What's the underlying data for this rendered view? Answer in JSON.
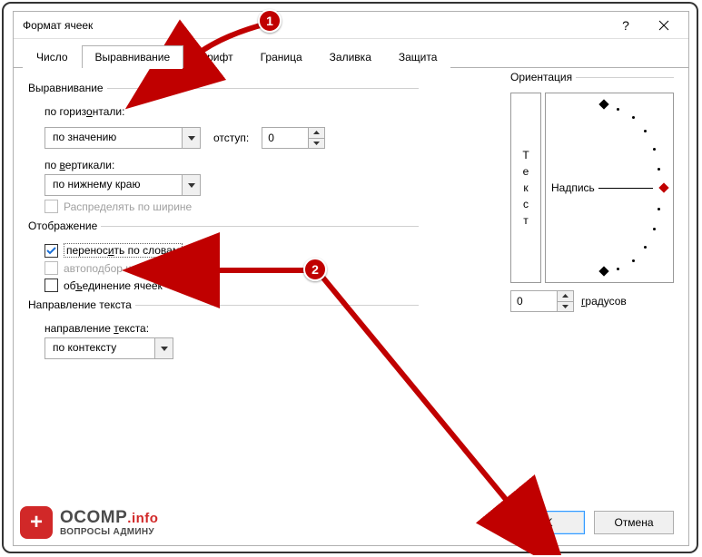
{
  "window": {
    "title": "Формат ячеек",
    "help_tooltip": "?",
    "close_tooltip": "Закрыть"
  },
  "tabs": [
    {
      "label": "Число"
    },
    {
      "label": "Выравнивание"
    },
    {
      "label": "Шрифт"
    },
    {
      "label": "Граница"
    },
    {
      "label": "Заливка"
    },
    {
      "label": "Защита"
    }
  ],
  "alignment": {
    "group_label": "Выравнивание",
    "horiz_label": "по горизонтали:",
    "horiz_value": "по значению",
    "indent_label": "отступ:",
    "indent_value": "0",
    "vert_label": "по вертикали:",
    "vert_value": "по нижнему краю",
    "justify_label": "Распределять по ширине"
  },
  "display": {
    "group_label": "Отображение",
    "wrap_label": "переносить по словам",
    "wrap_checked": true,
    "shrink_label": "автоподбор ширины",
    "merge_label": "объединение ячеек"
  },
  "textdir": {
    "group_label": "Направление текста",
    "dir_label": "направление текста:",
    "dir_value": "по контексту"
  },
  "orientation": {
    "group_label": "Ориентация",
    "vertical_text": "Текст",
    "dial_label": "Надпись",
    "degrees_value": "0",
    "degrees_label": "градусов"
  },
  "buttons": {
    "ok": "OK",
    "cancel": "Отмена"
  },
  "annotations": {
    "n1": "1",
    "n2": "2"
  },
  "watermark": {
    "plus": "+",
    "line1a": "OCOMP",
    "line1b": ".info",
    "line2": "ВОПРОСЫ АДМИНУ"
  }
}
